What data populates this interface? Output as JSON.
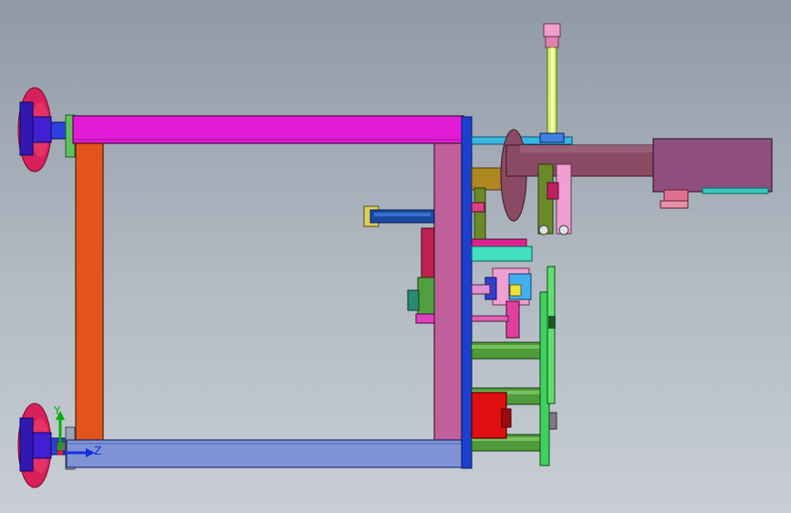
{
  "viewport": {
    "background_top": "#8f9aa6",
    "background_bottom": "#c9ced5"
  },
  "triad": {
    "y_label": "Y",
    "z_label": "Z",
    "y_color": "#00b000",
    "z_color": "#1030e0",
    "x_color": "#e02020"
  },
  "palette": {
    "frame_top": "#e21bd7",
    "frame_left": "#e2541b",
    "frame_right": "#c0609a",
    "frame_bottom": "#7f93d6",
    "plate": "#1b3fd0",
    "suction_cup": "#d8205a",
    "cylinder_body": "#8a4a63",
    "motor_box": "#8e4f7e",
    "slide_bar": "#c8e070",
    "guide_rod": "#4f9a3a",
    "red_block": "#e01010",
    "green_plate": "#40d060"
  }
}
